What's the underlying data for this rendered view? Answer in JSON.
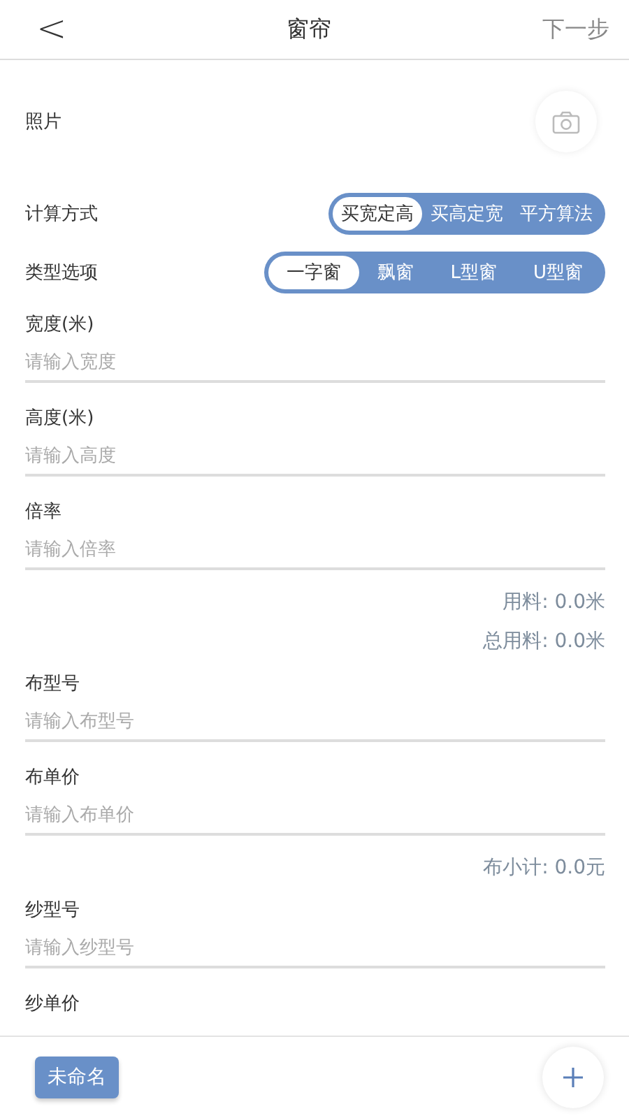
{
  "header": {
    "back": "<",
    "title": "窗帘",
    "action": "下一步"
  },
  "photo": {
    "label": "照片"
  },
  "segments": [
    {
      "label": "计算方式",
      "options": [
        {
          "label": "买宽定高",
          "selected": true
        },
        {
          "label": "买高定宽",
          "selected": false
        },
        {
          "label": "平方算法",
          "selected": false
        }
      ]
    },
    {
      "label": "类型选项",
      "options": [
        {
          "label": "一字窗",
          "selected": true
        },
        {
          "label": "飘窗",
          "selected": false
        },
        {
          "label": "L型窗",
          "selected": false
        },
        {
          "label": "U型窗",
          "selected": false
        }
      ]
    }
  ],
  "form": [
    {
      "kind": "field",
      "label": "宽度(米)",
      "placeholder": "请输入宽度"
    },
    {
      "kind": "field",
      "label": "高度(米)",
      "placeholder": "请输入高度"
    },
    {
      "kind": "field",
      "label": "倍率",
      "placeholder": "请输入倍率"
    },
    {
      "kind": "summary",
      "text": "用料: 0.0米"
    },
    {
      "kind": "summary",
      "text": "总用料: 0.0米"
    },
    {
      "kind": "field",
      "label": "布型号",
      "placeholder": "请输入布型号"
    },
    {
      "kind": "field",
      "label": "布单价",
      "placeholder": "请输入布单价"
    },
    {
      "kind": "summary",
      "text": "布小计: 0.0元"
    },
    {
      "kind": "field",
      "label": "纱型号",
      "placeholder": "请输入纱型号"
    },
    {
      "kind": "field",
      "label": "纱单价"
    }
  ],
  "footer": {
    "name_button": "未命名"
  }
}
